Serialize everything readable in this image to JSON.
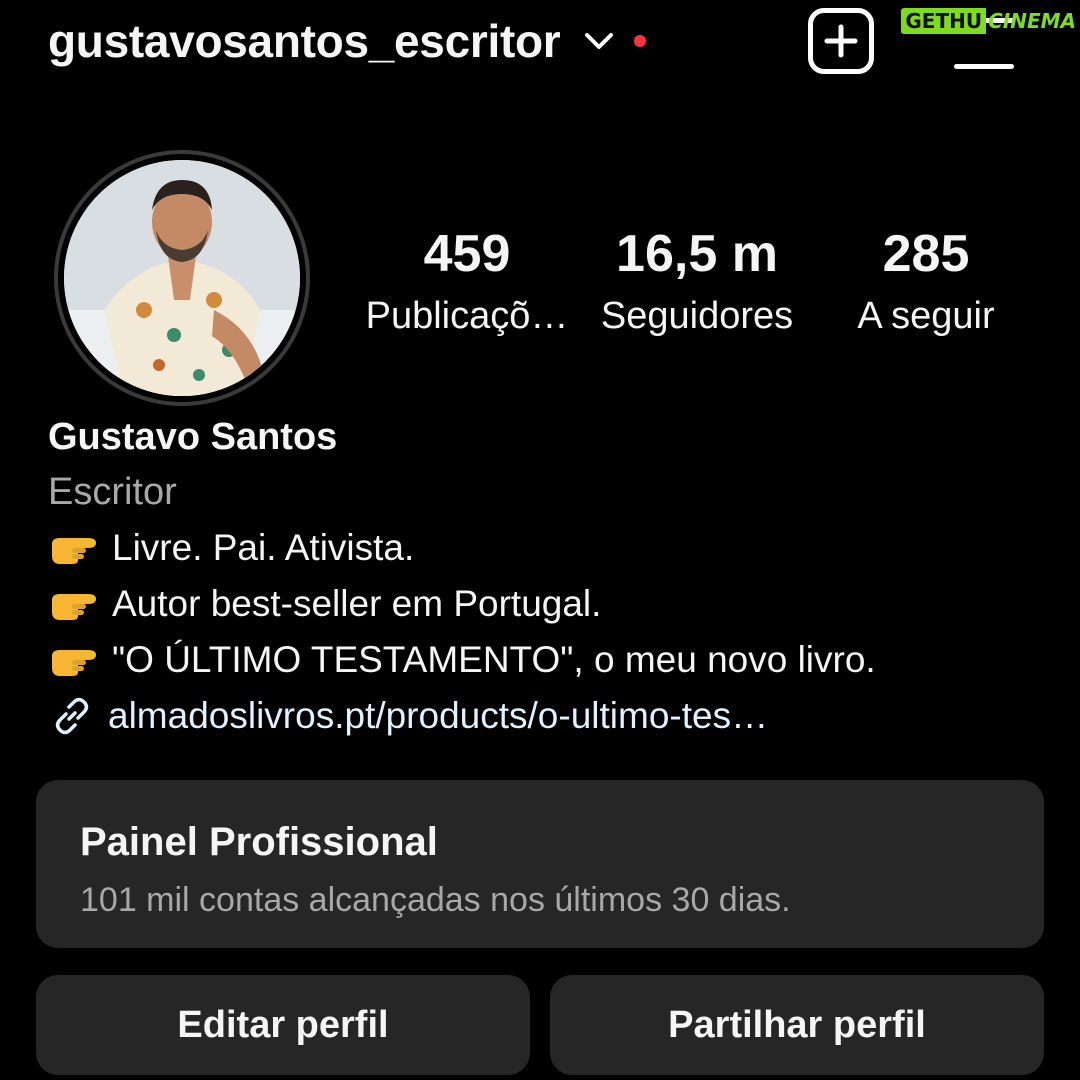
{
  "header": {
    "username": "gustavosantos_escritor",
    "notification_color": "#ff3040",
    "chevron_icon": "chevron-down-icon",
    "create_icon": "plus-square-icon",
    "menu_icon": "hamburger-menu-icon"
  },
  "watermark": {
    "left": "GETHU",
    "right": "CINEMA"
  },
  "profile": {
    "avatar": "profile-photo"
  },
  "stats": [
    {
      "value": "459",
      "label": "Publicaçõ…"
    },
    {
      "value": "16,5 m",
      "label": "Seguidores"
    },
    {
      "value": "285",
      "label": "A seguir"
    }
  ],
  "bio": {
    "name": "Gustavo Santos",
    "category": "Escritor",
    "lines": [
      "Livre. Pai. Ativista.",
      "Autor best-seller em Portugal.",
      "\"O ÚLTIMO TESTAMENTO\", o meu novo livro."
    ],
    "emoji_icon": "pointing-right-hand-icon",
    "link": "almadoslivros.pt/products/o-ultimo-tes…"
  },
  "panel": {
    "title": "Painel Profissional",
    "subtitle": "101 mil contas alcançadas nos últimos 30 dias."
  },
  "buttons": {
    "edit": "Editar perfil",
    "share": "Partilhar perfil"
  },
  "colors": {
    "background": "#000000",
    "surface": "#262626",
    "muted_text": "#a8a8a8",
    "watermark": "#7ddc1f"
  }
}
